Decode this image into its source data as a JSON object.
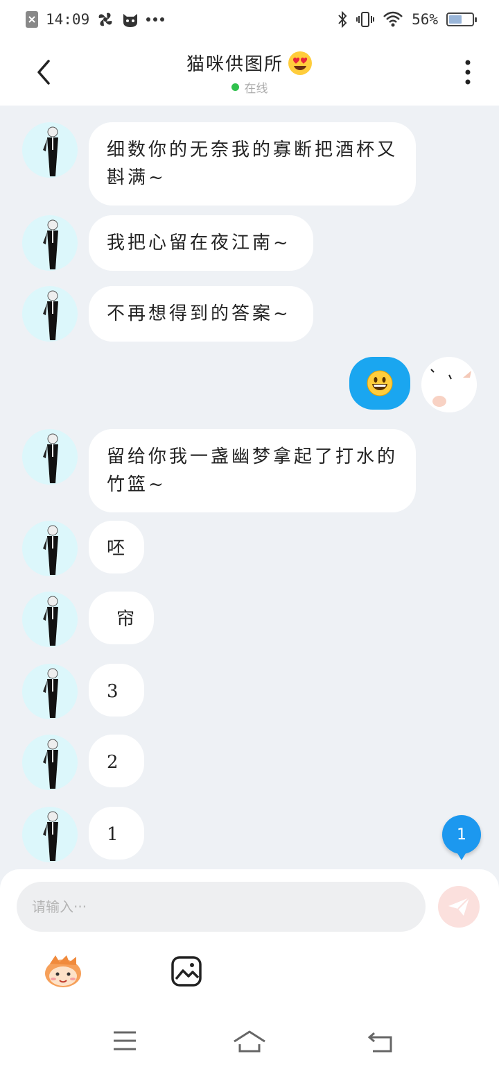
{
  "status_bar": {
    "time": "14:09",
    "battery_percent": "56%",
    "battery_level": 0.56
  },
  "header": {
    "title": "猫咪供图所",
    "status": "在线"
  },
  "messages": [
    {
      "side": "left",
      "text": "细数你的无奈我的寡断把酒杯又斟满~"
    },
    {
      "side": "left",
      "text": "我把心留在夜江南~"
    },
    {
      "side": "left",
      "text": "不再想得到的答案~"
    },
    {
      "side": "right",
      "text": "",
      "emoji": "grinning-face"
    },
    {
      "side": "left",
      "text": "留给你我一盏幽梦拿起了打水的竹篮~"
    },
    {
      "side": "left",
      "text": "呸"
    },
    {
      "side": "left",
      "text": "帘"
    },
    {
      "side": "left",
      "text": "3"
    },
    {
      "side": "left",
      "text": "2"
    },
    {
      "side": "left",
      "text": "1"
    }
  ],
  "unread_badge": "1",
  "composer": {
    "placeholder": "请输入···"
  },
  "colors": {
    "accent_blue": "#1aa6f0",
    "online_green": "#30c14d",
    "avatar_bg": "#dcf7fb"
  },
  "icons": [
    "back-icon",
    "more-icon",
    "heart-eyes-emoji-icon",
    "send-icon",
    "emoji-sticker-icon",
    "image-icon",
    "menu-icon",
    "home-icon",
    "return-icon"
  ]
}
